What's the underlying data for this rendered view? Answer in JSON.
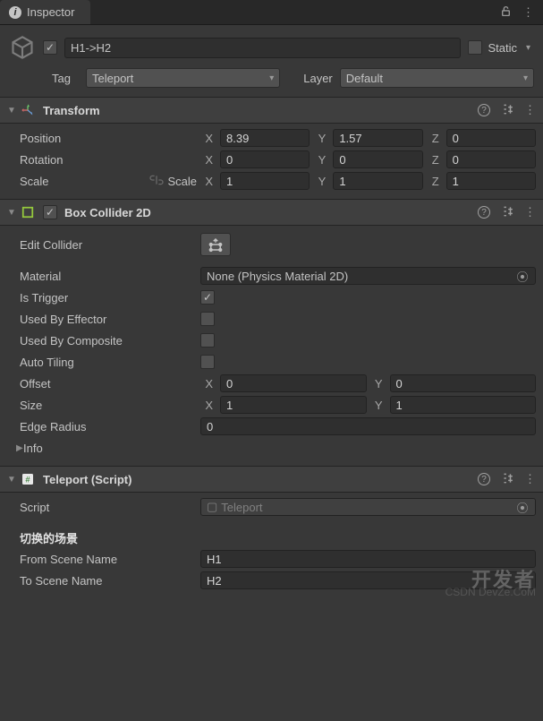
{
  "tab": {
    "title": "Inspector"
  },
  "top_icons": {
    "lock": "lock-icon",
    "menu": "⋮"
  },
  "object": {
    "enabled": true,
    "name": "H1->H2",
    "static_label": "Static",
    "static_checked": false,
    "tag_label": "Tag",
    "tag_value": "Teleport",
    "layer_label": "Layer",
    "layer_value": "Default"
  },
  "transform": {
    "title": "Transform",
    "position_label": "Position",
    "position": {
      "x": "8.39",
      "y": "1.57",
      "z": "0"
    },
    "rotation_label": "Rotation",
    "rotation": {
      "x": "0",
      "y": "0",
      "z": "0"
    },
    "scale_label": "Scale",
    "scale": {
      "x": "1",
      "y": "1",
      "z": "1"
    }
  },
  "box_collider": {
    "title": "Box Collider 2D",
    "enabled": true,
    "edit_label": "Edit Collider",
    "material_label": "Material",
    "material_value": "None (Physics Material 2D)",
    "is_trigger_label": "Is Trigger",
    "is_trigger": true,
    "used_by_effector_label": "Used By Effector",
    "used_by_effector": false,
    "used_by_composite_label": "Used By Composite",
    "used_by_composite": false,
    "auto_tiling_label": "Auto Tiling",
    "auto_tiling": false,
    "offset_label": "Offset",
    "offset": {
      "x": "0",
      "y": "0"
    },
    "size_label": "Size",
    "size": {
      "x": "1",
      "y": "1"
    },
    "edge_radius_label": "Edge Radius",
    "edge_radius": "0",
    "info_label": "Info"
  },
  "teleport": {
    "title": "Teleport (Script)",
    "script_label": "Script",
    "script_value": "Teleport",
    "section_header": "切换的场景",
    "from_label": "From Scene Name",
    "from_value": "H1",
    "to_label": "To Scene Name",
    "to_value": "H2"
  },
  "watermark": "开发者",
  "watermark2": "CSDN DevZe.CoM",
  "glyphs": {
    "x": "X",
    "y": "Y",
    "z": "Z",
    "help": "?"
  }
}
